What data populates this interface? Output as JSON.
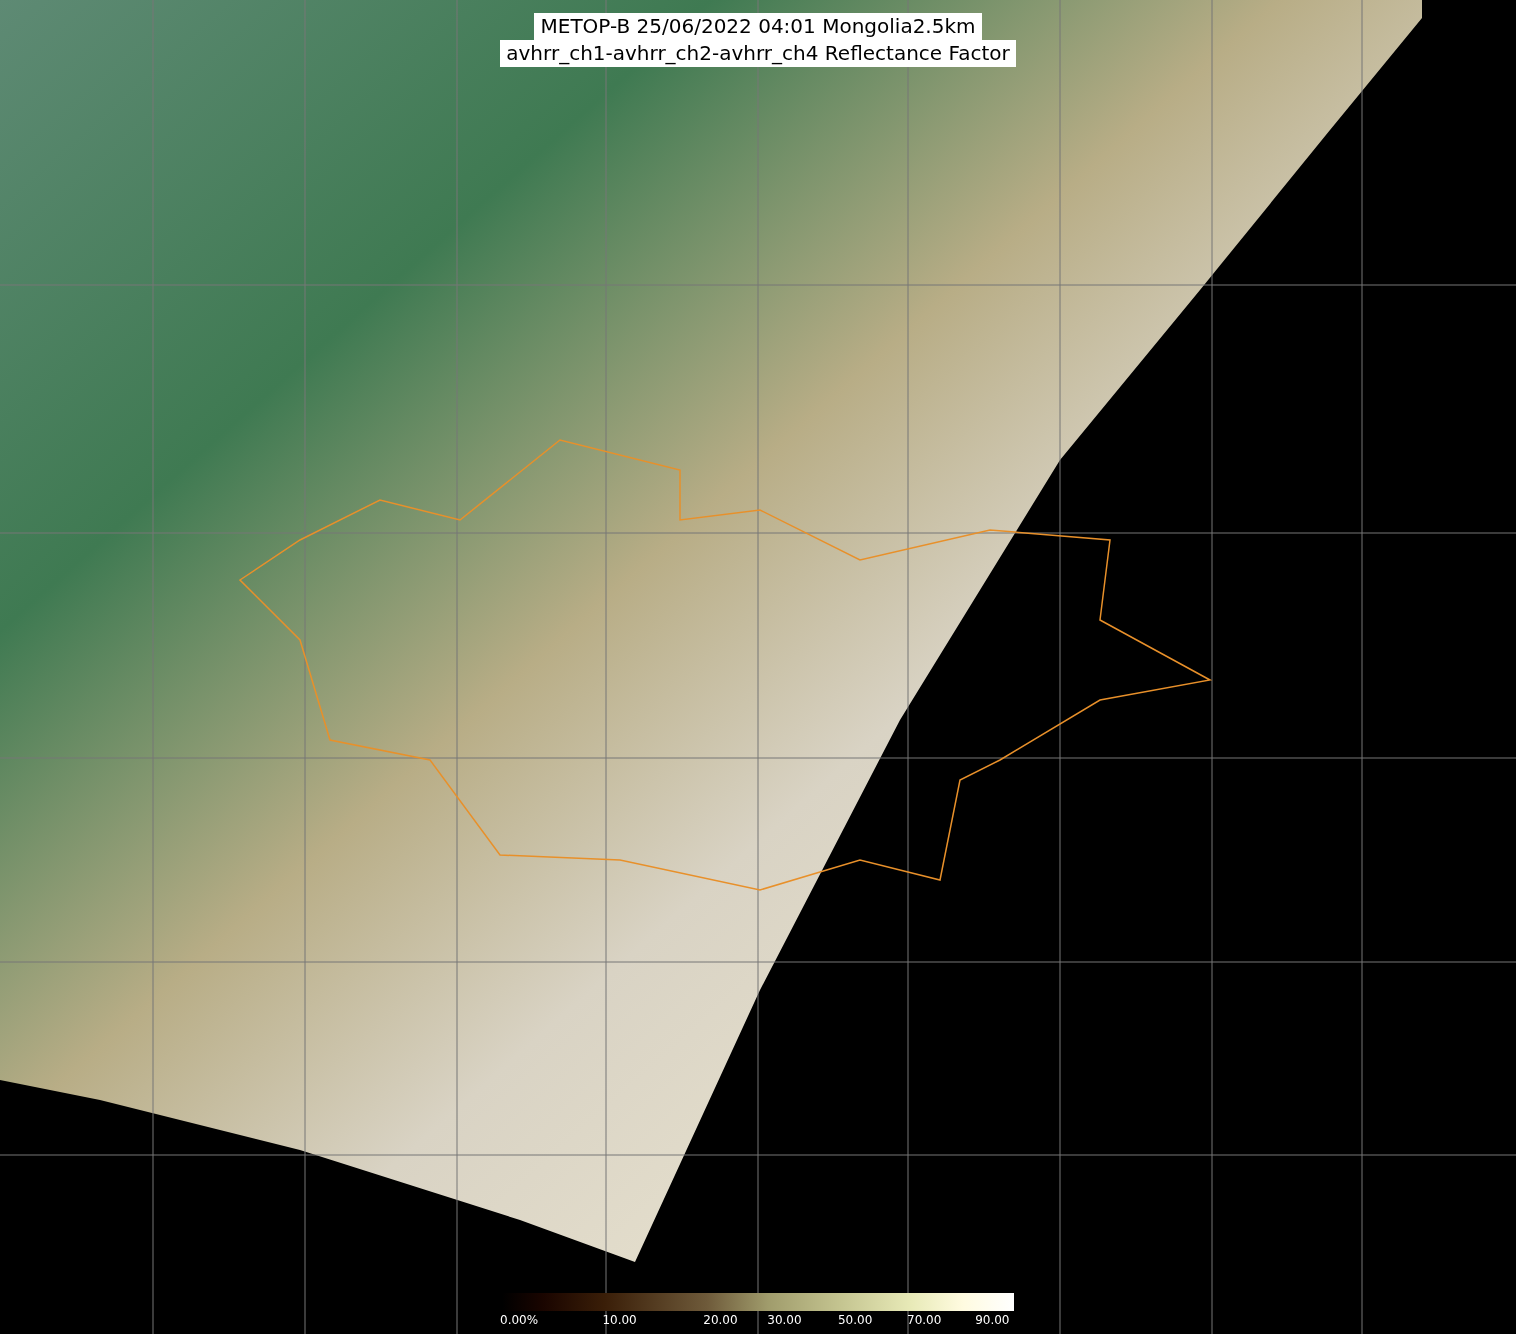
{
  "title": {
    "lines": [
      "METOP-B 25/06/2022 04:01 Mongolia2.5km",
      "avhrr_ch1-avhrr_ch2-avhrr_ch4 Reflectance Factor"
    ]
  },
  "colorbar": {
    "labels": [
      "0.00%",
      "10.00",
      "20.00",
      "30.00",
      "50.00",
      "70.00",
      "90.00"
    ]
  }
}
